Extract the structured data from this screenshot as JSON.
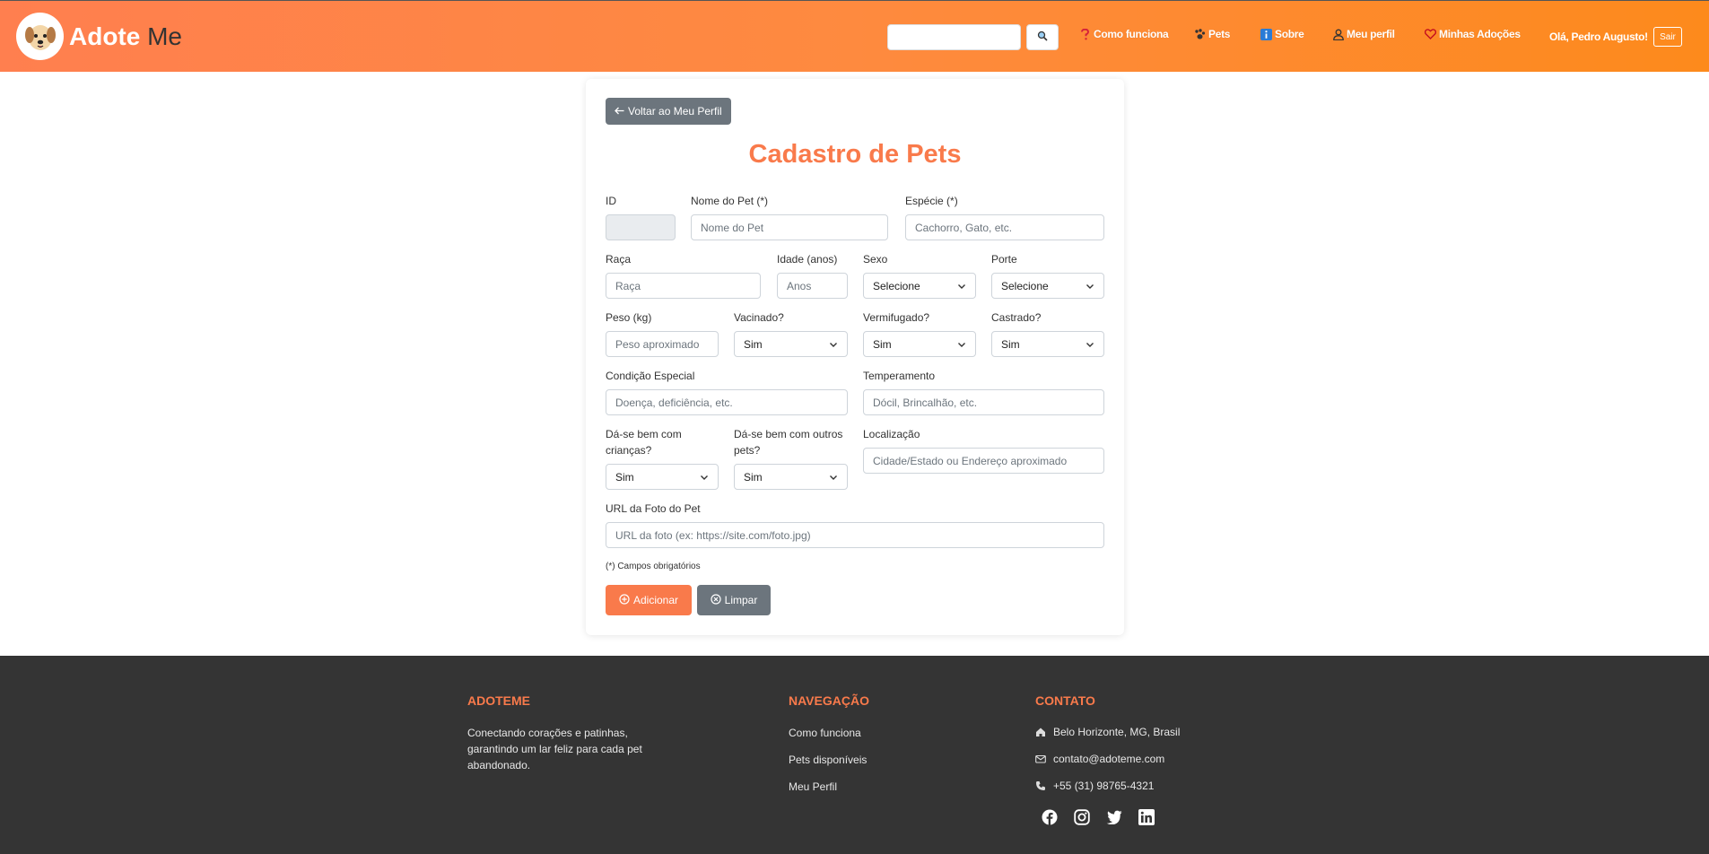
{
  "header": {
    "brand_bold": "Adote",
    "brand_light": "Me",
    "search_placeholder": "",
    "nav": [
      {
        "label": "Como funciona",
        "icon": "question-icon"
      },
      {
        "label": "Pets",
        "icon": "paw-icon"
      },
      {
        "label": "Sobre",
        "icon": "info-icon"
      },
      {
        "label": "Meu perfil",
        "icon": "user-icon"
      },
      {
        "label": "Minhas Adoções",
        "icon": "heart-icon"
      }
    ],
    "greeting": "Olá, Pedro Augusto!",
    "logout": "Sair"
  },
  "form": {
    "back_label": "Voltar ao Meu Perfil",
    "title": "Cadastro de Pets",
    "fields": {
      "id": {
        "label": "ID",
        "value": ""
      },
      "nome": {
        "label": "Nome do Pet (*)",
        "placeholder": "Nome do Pet"
      },
      "especie": {
        "label": "Espécie (*)",
        "placeholder": "Cachorro, Gato, etc."
      },
      "raca": {
        "label": "Raça",
        "placeholder": "Raça"
      },
      "idade": {
        "label": "Idade (anos)",
        "placeholder": "Anos"
      },
      "sexo": {
        "label": "Sexo",
        "value": "Selecione"
      },
      "porte": {
        "label": "Porte",
        "value": "Selecione"
      },
      "peso": {
        "label": "Peso (kg)",
        "placeholder": "Peso aproximado"
      },
      "vacinado": {
        "label": "Vacinado?",
        "value": "Sim"
      },
      "vermifugado": {
        "label": "Vermifugado?",
        "value": "Sim"
      },
      "castrado": {
        "label": "Castrado?",
        "value": "Sim"
      },
      "condicao": {
        "label": "Condição Especial",
        "placeholder": "Doença, deficiência, etc."
      },
      "temperamento": {
        "label": "Temperamento",
        "placeholder": "Dócil, Brincalhão, etc."
      },
      "criancas": {
        "label_1": "Dá-se bem com",
        "label_2": "crianças?",
        "value": "Sim"
      },
      "outros_pets": {
        "label_1": "Dá-se bem com outros",
        "label_2": "pets?",
        "value": "Sim"
      },
      "localizacao": {
        "label": "Localização",
        "placeholder": "Cidade/Estado ou Endereço aproximado"
      },
      "foto": {
        "label": "URL da Foto do Pet",
        "placeholder": "URL da foto (ex: https://site.com/foto.jpg)"
      }
    },
    "required_note": "(*) Campos obrigatórios",
    "add_label": "Adicionar",
    "clear_label": "Limpar"
  },
  "footer": {
    "about": {
      "heading": "ADOTEME",
      "line1": "Conectando corações e patinhas,",
      "line2": "garantindo um lar feliz para cada pet",
      "line3": "abandonado."
    },
    "nav": {
      "heading": "NAVEGAÇÃO",
      "links": [
        "Como funciona",
        "Pets disponíveis",
        "Meu Perfil"
      ]
    },
    "contact": {
      "heading": "CONTATO",
      "address": "Belo Horizonte, MG, Brasil",
      "email": "contato@adoteme.com",
      "phone": "+55 (31) 98765-4321"
    },
    "social": [
      "facebook-icon",
      "instagram-icon",
      "twitter-icon",
      "linkedin-icon"
    ]
  },
  "colors": {
    "accent": "#f97a4b",
    "header_gradient_start": "#ff7f4f",
    "header_gradient_end": "#fd8a1c",
    "secondary": "#6c757d",
    "footer_bg": "#343434"
  }
}
